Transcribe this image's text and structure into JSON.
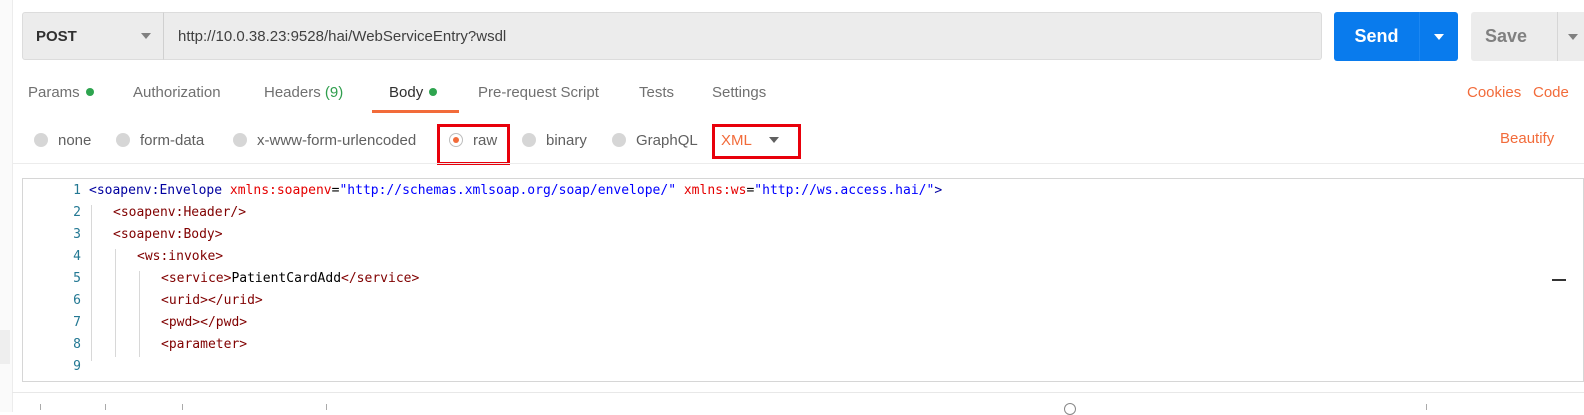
{
  "request": {
    "method": "POST",
    "url": "http://10.0.38.23:9528/hai/WebServiceEntry?wsdl",
    "send_label": "Send",
    "save_label": "Save"
  },
  "tabs": [
    {
      "label": "Params",
      "dot": true
    },
    {
      "label": "Authorization"
    },
    {
      "label": "Headers",
      "count": "(9)"
    },
    {
      "label": "Body",
      "dot": true,
      "active": true
    },
    {
      "label": "Pre-request Script"
    },
    {
      "label": "Tests"
    },
    {
      "label": "Settings"
    }
  ],
  "right_links": {
    "cookies": "Cookies",
    "code": "Code"
  },
  "body_types": [
    {
      "label": "none"
    },
    {
      "label": "form-data"
    },
    {
      "label": "x-www-form-urlencoded"
    },
    {
      "label": "raw",
      "selected": true
    },
    {
      "label": "binary"
    },
    {
      "label": "GraphQL"
    }
  ],
  "language": "XML",
  "beautify_label": "Beautify",
  "editor": {
    "line_numbers": [
      "1",
      "2",
      "3",
      "4",
      "5",
      "6",
      "7",
      "8",
      "9"
    ],
    "line1": {
      "open": "<soapenv:Envelope",
      "attr1": "xmlns:soapenv",
      "val1": "\"http://schemas.xmlsoap.org/soap/envelope/\"",
      "attr2": "xmlns:ws",
      "val2": "\"http://ws.access.hai/\"",
      "close": ">"
    },
    "line2": "<soapenv:Header/>",
    "line3": "<soapenv:Body>",
    "line4": "<ws:invoke>",
    "line5": {
      "open": "<service>",
      "text": "PatientCardAdd",
      "close": "</service>"
    },
    "line6": "<urid></urid>",
    "line7": "<pwd></pwd>",
    "line8": "<parameter>"
  },
  "colors": {
    "accent": "#f26b3a",
    "send": "#097bed",
    "dot": "#2ea44f",
    "highlight": "#e8000b"
  }
}
